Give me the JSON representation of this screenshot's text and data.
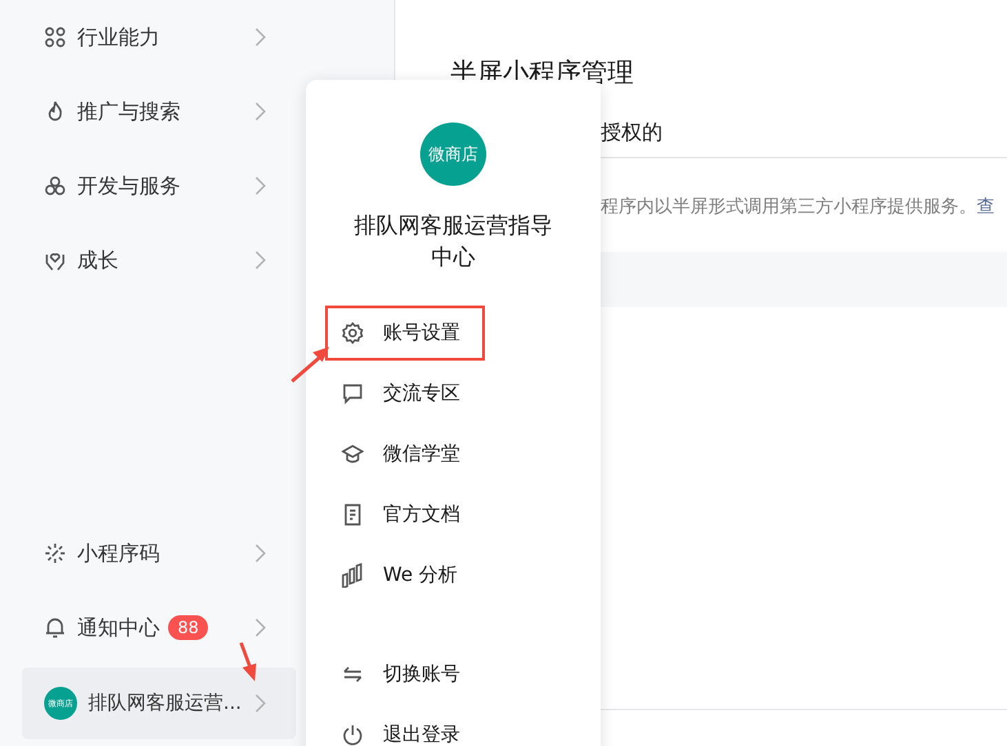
{
  "sidebar": {
    "items": [
      {
        "kind": "nodes",
        "label": "行业能力"
      },
      {
        "kind": "flame",
        "label": "推广与搜索"
      },
      {
        "kind": "clover",
        "label": "开发与服务"
      },
      {
        "kind": "hands",
        "label": "成长"
      }
    ],
    "bottom_items": [
      {
        "kind": "code",
        "label": "小程序码"
      },
      {
        "kind": "bell",
        "label": "通知中心",
        "badge": "88"
      }
    ],
    "account": {
      "avatar_text": "微商店",
      "name": "排队网客服运营..."
    }
  },
  "main": {
    "title": "半屏小程序管理",
    "tab": "授权的",
    "description": "程序内以半屏形式调用第三方小程序提供服务。",
    "link": "查"
  },
  "popup": {
    "avatar_text": "微商店",
    "name": "排队网客服运营指导中心",
    "menu": [
      {
        "kind": "gear",
        "label": "账号设置",
        "highlighted": true
      },
      {
        "kind": "chat",
        "label": "交流专区",
        "highlighted": false
      },
      {
        "kind": "cap",
        "label": "微信学堂",
        "highlighted": false
      },
      {
        "kind": "doc",
        "label": "官方文档",
        "highlighted": false
      },
      {
        "kind": "chart",
        "label": "We 分析",
        "highlighted": false
      }
    ],
    "actions": [
      {
        "kind": "switch",
        "label": "切换账号"
      },
      {
        "kind": "power",
        "label": "退出登录"
      }
    ]
  }
}
